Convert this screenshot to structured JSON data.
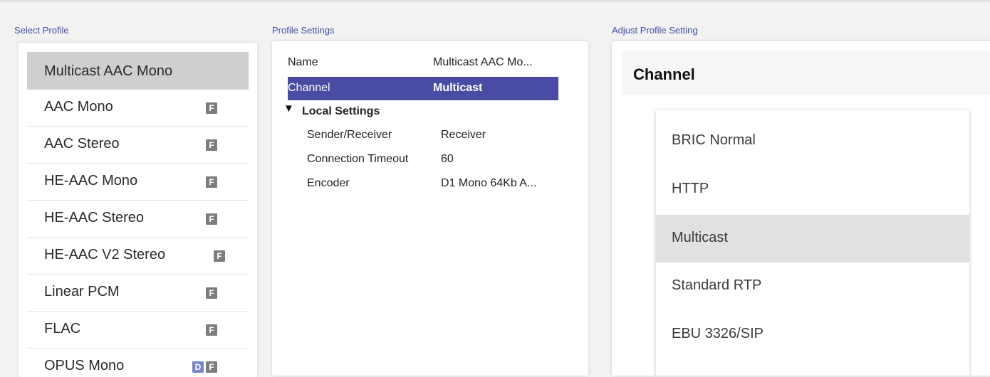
{
  "columns": {
    "select_profile": "Select Profile",
    "profile_settings": "Profile Settings",
    "adjust_setting": "Adjust Profile Setting"
  },
  "profiles": [
    {
      "label": "Multicast AAC Mono",
      "selected": true,
      "badges": []
    },
    {
      "label": "AAC Mono",
      "selected": false,
      "badges": [
        "F"
      ]
    },
    {
      "label": "AAC Stereo",
      "selected": false,
      "badges": [
        "F"
      ]
    },
    {
      "label": "HE-AAC Mono",
      "selected": false,
      "badges": [
        "F"
      ]
    },
    {
      "label": "HE-AAC Stereo",
      "selected": false,
      "badges": [
        "F"
      ]
    },
    {
      "label": "HE-AAC V2 Stereo",
      "selected": false,
      "badges": [
        "F"
      ]
    },
    {
      "label": "Linear PCM",
      "selected": false,
      "badges": [
        "F"
      ]
    },
    {
      "label": "FLAC",
      "selected": false,
      "badges": [
        "F"
      ]
    },
    {
      "label": "OPUS Mono",
      "selected": false,
      "badges": [
        "D",
        "F"
      ]
    }
  ],
  "settings": {
    "name_label": "Name",
    "name_value": "Multicast AAC Mo...",
    "channel_label": "Channel",
    "channel_value": "Multicast",
    "local_section": "Local Settings",
    "sender_label": "Sender/Receiver",
    "sender_value": "Receiver",
    "timeout_label": "Connection Timeout",
    "timeout_value": "60",
    "encoder_label": "Encoder",
    "encoder_value": "D1 Mono 64Kb A..."
  },
  "adjust": {
    "title": "Channel",
    "options": [
      {
        "label": "BRIC Normal",
        "selected": false
      },
      {
        "label": "HTTP",
        "selected": false
      },
      {
        "label": "Multicast",
        "selected": true
      },
      {
        "label": "Standard RTP",
        "selected": false
      },
      {
        "label": "EBU 3326/SIP",
        "selected": false
      }
    ]
  },
  "colors": {
    "accent": "#4a4ba2",
    "column_title": "#3d4fa3",
    "selected_row": "#cfcfcf",
    "badge": "#7d7d7d",
    "badge_d": "#7785c9"
  }
}
